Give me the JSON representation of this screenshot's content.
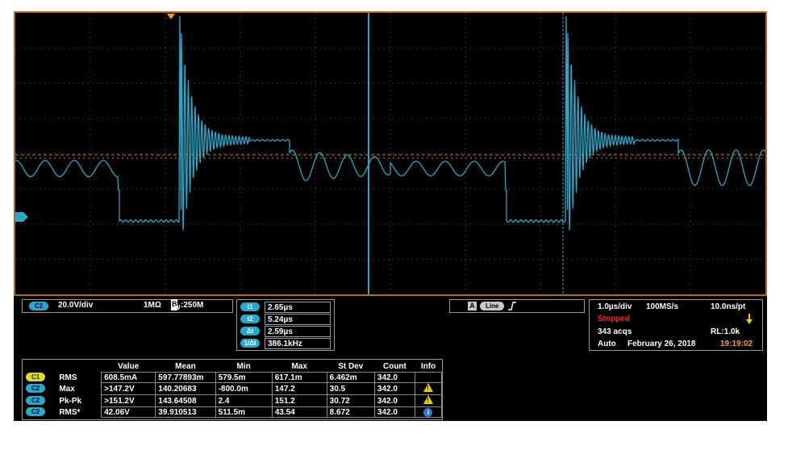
{
  "channel": {
    "label": "C2",
    "scale": "20.0V/div",
    "impedance": "1MΩ",
    "bw_prefix": "B",
    "bw_sub": "W",
    "bandwidth": ":250M"
  },
  "cursors": [
    {
      "label": "t1",
      "value": "2.65µs"
    },
    {
      "label": "t2",
      "value": "5.24µs"
    },
    {
      "label": "Δt",
      "value": "2.59µs"
    },
    {
      "label": "1/Δt",
      "value": "386.1kHz"
    }
  ],
  "trigger": {
    "source": "A",
    "type": "Line",
    "slope_icon": "rising-edge-icon"
  },
  "acquisition": {
    "timebase": "1.0µs/div",
    "sample_rate": "100MS/s",
    "resolution": "10.0ns/pt",
    "state": "Stopped",
    "acqs": "343 acqs",
    "record_length": "RL:1.0k",
    "mode": "Auto",
    "date": "February 26, 2018",
    "time": "19:19:02"
  },
  "measurements": {
    "headers": [
      "Value",
      "Mean",
      "Min",
      "Max",
      "St Dev",
      "Count",
      "Info"
    ],
    "rows": [
      {
        "channel": "C1",
        "name": "RMS",
        "value": "608.5mA",
        "mean": "597.77893m",
        "min": "579.5m",
        "max": "617.1m",
        "stdev": "6.462m",
        "count": "342.0",
        "info": ""
      },
      {
        "channel": "C2",
        "name": "Max",
        "value": ">147.2V",
        "mean": "140.20683",
        "min": "-800.0m",
        "max": "147.2",
        "stdev": "30.5",
        "count": "342.0",
        "info": "warning-icon"
      },
      {
        "channel": "C2",
        "name": "Pk-Pk",
        "value": ">151.2V",
        "mean": "143.64508",
        "min": "2.4",
        "max": "151.2",
        "stdev": "30.72",
        "count": "342.0",
        "info": "warning-icon"
      },
      {
        "channel": "C2",
        "name": "RMS*",
        "value": "42.06V",
        "mean": "39.910513",
        "min": "511.5m",
        "max": "43.54",
        "stdev": "8.672",
        "count": "342.0",
        "info": "info-icon"
      }
    ]
  },
  "colors": {
    "trace": "#2aa7c9",
    "grid": "#555555",
    "trigger_level": "#e07a1a",
    "frame": "#b5651d",
    "stopped": "#ff2020",
    "time": "#f0a030"
  }
}
